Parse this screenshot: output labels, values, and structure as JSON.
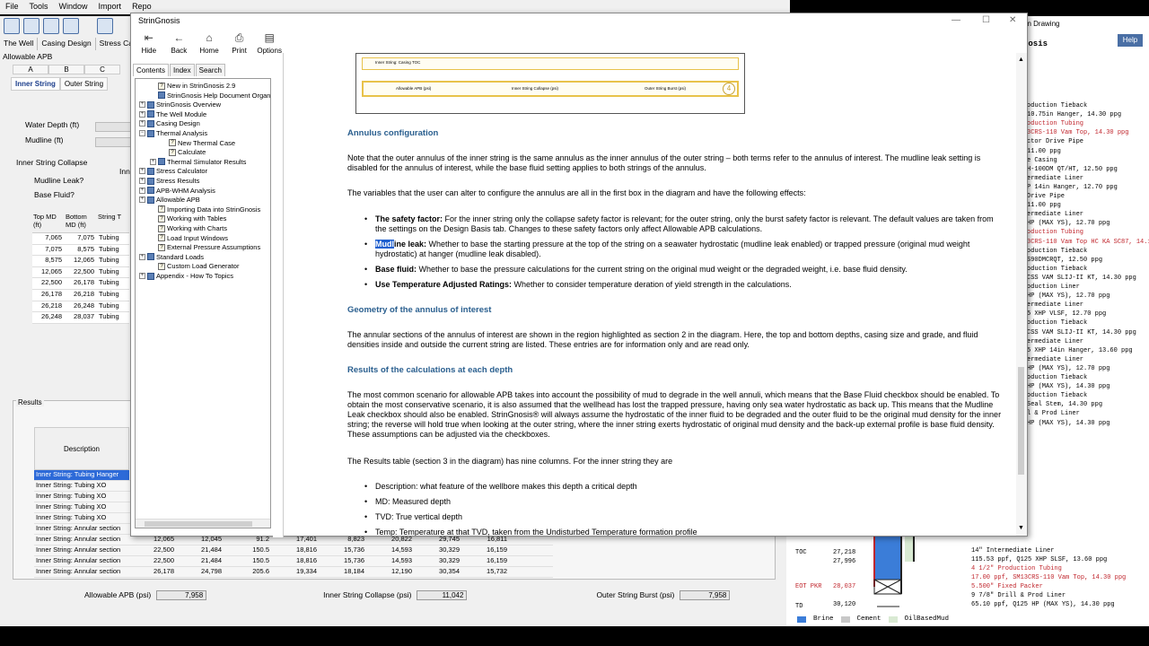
{
  "app": {
    "menu": [
      "File",
      "Tools",
      "Window",
      "Import",
      "Repo"
    ],
    "module_tabs": [
      "The Well",
      "Casing Design",
      "Stress Calcul"
    ],
    "section_label": "Allowable APB",
    "column_tabs": [
      "A",
      "B",
      "C"
    ],
    "string_tabs": [
      "Inner String",
      "Outer String"
    ],
    "fields": {
      "water_depth_label": "Water Depth (ft)",
      "mudline_label": "Mudline (ft)",
      "group_title": "Inner String Collapse",
      "mudline_leak_label": "Mudline Leak?",
      "base_fluid_label": "Base Fluid?",
      "partial_label": "Inn"
    },
    "mini_grid": {
      "headers": [
        "Top MD (ft)",
        "Bottom MD (ft)",
        "String T"
      ],
      "rows": [
        [
          "7,065",
          "7,075",
          "Tubing"
        ],
        [
          "7,075",
          "8,575",
          "Tubing"
        ],
        [
          "8,575",
          "12,065",
          "Tubing"
        ],
        [
          "12,065",
          "22,500",
          "Tubing"
        ],
        [
          "22,500",
          "26,178",
          "Tubing"
        ],
        [
          "26,178",
          "26,218",
          "Tubing"
        ],
        [
          "26,218",
          "26,248",
          "Tubing"
        ],
        [
          "26,248",
          "28,037",
          "Tubing"
        ]
      ]
    },
    "results": {
      "title": "Results",
      "desc_header": "Description",
      "rows": [
        {
          "d": "Inner String: Tubing Hanger",
          "n": []
        },
        {
          "d": "Inner String: Tubing XO",
          "n": []
        },
        {
          "d": "Inner String: Tubing XO",
          "n": []
        },
        {
          "d": "Inner String: Tubing XO",
          "n": []
        },
        {
          "d": "Inner String: Tubing XO",
          "n": []
        },
        {
          "d": "Inner String: Annular section",
          "n": []
        },
        {
          "d": "Inner String: Annular section",
          "n": [
            "12,065",
            "12,045",
            "91.2",
            "17,401",
            "8,823",
            "20,822",
            "29,745",
            "16,811"
          ]
        },
        {
          "d": "Inner String: Annular section",
          "n": [
            "22,500",
            "21,484",
            "150.5",
            "18,816",
            "15,736",
            "14,593",
            "30,329",
            "16,159"
          ]
        },
        {
          "d": "Inner String: Annular section",
          "n": [
            "22,500",
            "21,484",
            "150.5",
            "18,816",
            "15,736",
            "14,593",
            "30,329",
            "16,159"
          ]
        },
        {
          "d": "Inner String: Annular section",
          "n": [
            "26,178",
            "24,798",
            "205.6",
            "19,334",
            "18,184",
            "12,190",
            "30,354",
            "15,732"
          ]
        }
      ]
    },
    "footer": {
      "apb_label": "Allowable APB (psi)",
      "apb_value": "7,958",
      "collapse_label": "Inner String Collapse (psi)",
      "collapse_value": "11,042",
      "burst_label": "Outer String Burst (psi)",
      "burst_value": "7,958"
    }
  },
  "right_panel": {
    "header": "on Drawing",
    "help": "Help",
    "title": "nosis",
    "labels": [
      {
        "t": "oduction Tieback",
        "red": false
      },
      {
        "t": "10.75in Hanger, 14.30 ppg",
        "red": false
      },
      {
        "t": "oduction Tubing",
        "red": true
      },
      {
        "t": "3CRS-110 Vam Top, 14.30 ppg",
        "red": true
      },
      {
        "t": "ctor Drive Pipe",
        "red": false
      },
      {
        "t": " 11.00 ppg",
        "red": false
      },
      {
        "t": "e Casing",
        "red": false
      },
      {
        "t": "H-100DM QT/HT, 12.50 ppg",
        "red": false
      },
      {
        "t": "ermediate Liner",
        "red": false
      },
      {
        "t": "P 14in Hanger, 12.70 ppg",
        "red": false
      },
      {
        "t": "Drive Pipe",
        "red": false
      },
      {
        "t": " 11.00 ppg",
        "red": false
      },
      {
        "t": "ermediate Liner",
        "red": false
      },
      {
        "t": "HP (MAX YS), 12.70 ppg",
        "red": false
      },
      {
        "t": "oduction Tubing",
        "red": true
      },
      {
        "t": "3CRS-110 Vam Top HC KA SC87, 14.10 ppg",
        "red": true
      },
      {
        "t": "oduction Tieback",
        "red": false
      },
      {
        "t": "S90DMCRQT, 12.50 ppg",
        "red": false
      },
      {
        "t": "oduction Tieback",
        "red": false
      },
      {
        "t": "CSS VAM SLIJ-II KT, 14.30 ppg",
        "red": false
      },
      {
        "t": "oduction Liner",
        "red": false
      },
      {
        "t": "HP (MAX YS), 12.70 ppg",
        "red": false
      },
      {
        "t": "ermediate Liner",
        "red": false
      },
      {
        "t": "5 XHP VLSF, 12.70 ppg",
        "red": false
      },
      {
        "t": "oduction Tieback",
        "red": false
      },
      {
        "t": "CSS VAM SLIJ-II KT, 14.30 ppg",
        "red": false
      },
      {
        "t": "ermediate Liner",
        "red": false
      },
      {
        "t": "5 XHP 14in Hanger, 13.60 ppg",
        "red": false
      },
      {
        "t": "ermediate Liner",
        "red": false
      },
      {
        "t": "HP (MAX YS), 12.70 ppg",
        "red": false
      },
      {
        "t": "oduction Tieback",
        "red": false
      },
      {
        "t": "HP (MAX YS), 14.30 ppg",
        "red": false
      },
      {
        "t": "oduction Tieback",
        "red": false
      },
      {
        "t": "Seal Stem, 14.30 ppg",
        "red": false
      },
      {
        "t": "l & Prod Liner",
        "red": false
      },
      {
        "t": "HP (MAX YS), 14.30 ppg",
        "red": false
      }
    ],
    "bottom": {
      "toc": "TOC",
      "toc_val1": "27,218",
      "toc_val2": "27,996",
      "eot": "EOT PKR",
      "eot_val": "28,037",
      "td": "TD",
      "td_val": "30,120",
      "lines": [
        {
          "t": "14\" Intermediate Liner",
          "red": false
        },
        {
          "t": "115.53 ppf, Q125 XHP SLSF, 13.60 ppg",
          "red": false
        },
        {
          "t": "4 1/2\" Production Tubing",
          "red": true
        },
        {
          "t": "17.00 ppf, SM13CRS-110 Vam Top, 14.30 ppg",
          "red": true
        },
        {
          "t": "5.500\" Fixed Packer",
          "red": true
        },
        {
          "t": "9 7/8\" Drill & Prod Liner",
          "red": false
        },
        {
          "t": "65.10 ppf, Q125 HP (MAX YS), 14.30 ppg",
          "red": false
        }
      ],
      "legend": [
        "Brine",
        "Cement",
        "OilBasedMud"
      ],
      "legend_colors": [
        "#3b7dd8",
        "#c8c8c8",
        "#d9ead3"
      ]
    }
  },
  "help_window": {
    "title": "StrinGnosis",
    "toolbar": [
      {
        "label": "Hide",
        "icon": "hide-icon",
        "glyph": "⇤"
      },
      {
        "label": "Back",
        "icon": "back-icon",
        "glyph": "←"
      },
      {
        "label": "Home",
        "icon": "home-icon",
        "glyph": "⌂"
      },
      {
        "label": "Print",
        "icon": "print-icon",
        "glyph": "⎙"
      },
      {
        "label": "Options",
        "icon": "options-icon",
        "glyph": "▤"
      }
    ],
    "nav_tabs": [
      "Contents",
      "Index",
      "Search"
    ],
    "toc": [
      {
        "label": "New in StrinGnosis 2.9",
        "level": 1,
        "kind": "page",
        "exp": ""
      },
      {
        "label": "StrinGnosis Help Document Organizat",
        "level": 1,
        "kind": "book",
        "exp": ""
      },
      {
        "label": "StrinGnosis Overview",
        "level": 0,
        "kind": "book",
        "exp": "+"
      },
      {
        "label": "The Well Module",
        "level": 0,
        "kind": "book",
        "exp": "+"
      },
      {
        "label": "Casing Design",
        "level": 0,
        "kind": "book",
        "exp": "+"
      },
      {
        "label": "Thermal Analysis",
        "level": 0,
        "kind": "book",
        "exp": "−"
      },
      {
        "label": "New Thermal Case",
        "level": 2,
        "kind": "page",
        "exp": ""
      },
      {
        "label": "Calculate",
        "level": 2,
        "kind": "page",
        "exp": ""
      },
      {
        "label": "Thermal Simulator Results",
        "level": 1,
        "kind": "book",
        "exp": "+"
      },
      {
        "label": "Stress Calculator",
        "level": 0,
        "kind": "book",
        "exp": "+"
      },
      {
        "label": "Stress Results",
        "level": 0,
        "kind": "book",
        "exp": "+"
      },
      {
        "label": "APB-WHM Analysis",
        "level": 0,
        "kind": "book",
        "exp": "+"
      },
      {
        "label": "Allowable APB",
        "level": 0,
        "kind": "book",
        "exp": "+"
      },
      {
        "label": "Importing Data into StrinGnosis",
        "level": 1,
        "kind": "page",
        "exp": ""
      },
      {
        "label": "Working with Tables",
        "level": 1,
        "kind": "page",
        "exp": ""
      },
      {
        "label": "Working with Charts",
        "level": 1,
        "kind": "page",
        "exp": ""
      },
      {
        "label": "Load Input Windows",
        "level": 1,
        "kind": "page",
        "exp": ""
      },
      {
        "label": "External Pressure Assumptions",
        "level": 1,
        "kind": "page",
        "exp": ""
      },
      {
        "label": "Standard Loads",
        "level": 0,
        "kind": "book",
        "exp": "+"
      },
      {
        "label": "Custom Load Generator",
        "level": 1,
        "kind": "page",
        "exp": ""
      },
      {
        "label": "Appendix - How To Topics",
        "level": 0,
        "kind": "book",
        "exp": "+"
      }
    ],
    "content": {
      "diagram_row1": "Inner String: Casing TOC",
      "diagram_row2_a": "Allowable APB (psi)",
      "diagram_row2_b": "Inner String Collapse (psi)",
      "diagram_row2_c": "Outer String Burst (psi)",
      "diagram_badge": "4",
      "h_annulus": "Annulus configuration",
      "p_annulus": "Note that the outer annulus of the inner string is the same annulus as the inner annulus of the outer string – both terms refer to the annulus of interest. The mudline leak setting is disabled for the annulus of interest, while the base fluid setting applies to both strings of the annulus.",
      "p_variables": "The variables that the user can alter to configure the annulus are all in the first box in the diagram and have the following effects:",
      "li1_b": "The safety factor:",
      "li1_t": " For the inner string only the collapse safety factor is relevant; for the outer string, only the burst safety factor is relevant. The default values are taken from the settings on the Design Basis tab. Changes to these safety factors only affect Allowable APB calculations.",
      "li2_hl": "Mudl",
      "li2_b": "ine leak:",
      "li2_t": " Whether to base the starting pressure at the top of the string on a seawater hydrostatic (mudline leak enabled) or trapped pressure (original mud weight hydrostatic) at hanger (mudline leak disabled).",
      "li3_b": "Base fluid:",
      "li3_t": " Whether to base the pressure calculations for the current string on the original mud weight or the degraded weight, i.e. base fluid density.",
      "li4_b": "Use Temperature Adjusted Ratings:",
      "li4_t": " Whether to consider temperature deration of yield strength in the calculations.",
      "h_geometry": "Geometry of the annulus of interest",
      "p_geometry": "The annular sections of the annulus of interest are shown in the region highlighted as section 2 in the diagram. Here, the top and bottom depths, casing size and grade, and fluid densities inside and outside the current string are listed. These entries are for information only and are read only.",
      "h_results": "Results of the calculations at each depth",
      "p_results": "The most common scenario for allowable APB takes into account the possibility of mud to degrade in the well annuli, which means that the Base Fluid checkbox should be enabled. To obtain the most conservative scenario, it is also assumed that the wellhead has lost the trapped pressure, having only sea water hydrostatic as back up. This means that the Mudline Leak checkbox should also be enabled. StrinGnosis® will always assume the hydrostatic of the inner fluid to be degraded and the outer fluid to be the original mud density for the inner string; the reverse will hold true when looking at the outer string, where the inner string exerts hydrostatic of original mud density and the back-up external profile is base fluid density. These assumptions can be adjusted via the checkboxes.",
      "p_table": "The Results table (section 3 in the diagram) has nine columns. For the inner string they are",
      "col1": "Description: what feature of the wellbore makes this depth a critical depth",
      "col2": "MD: Measured depth",
      "col3": "TVD: True vertical depth",
      "col4": "Temp: Temperature at that TVD, taken from the Undisturbed Temperature formation profile"
    }
  }
}
